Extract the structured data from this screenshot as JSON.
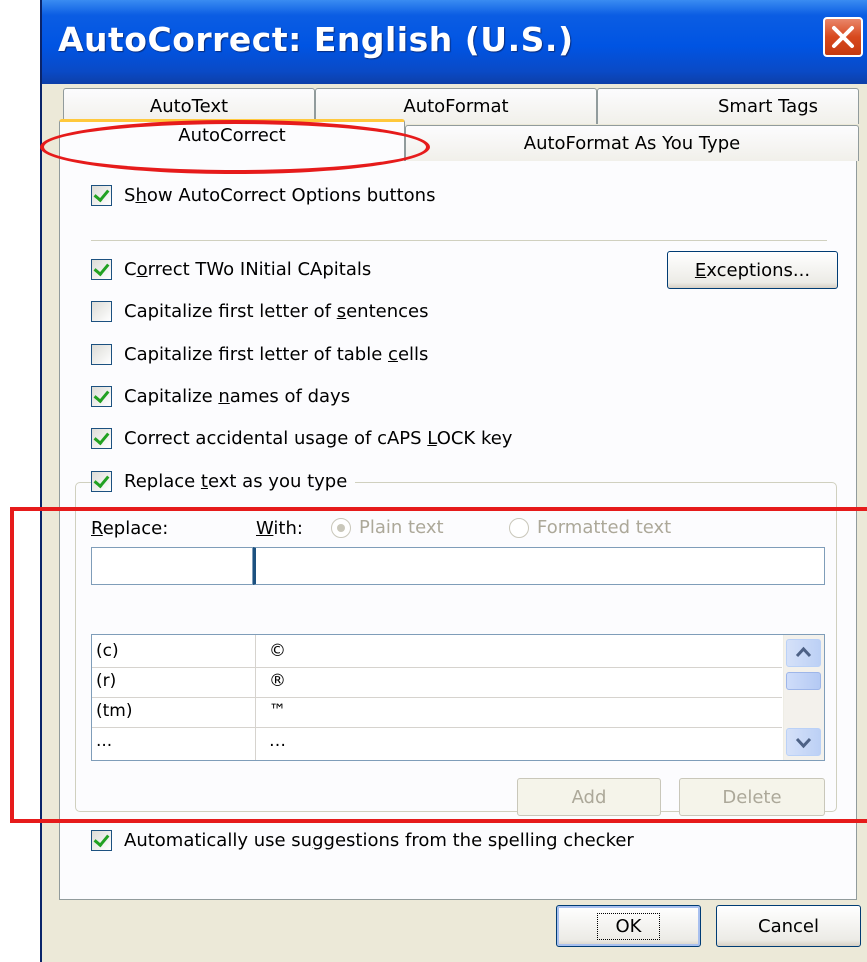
{
  "window": {
    "title": "AutoCorrect: English (U.S.)"
  },
  "tabs": {
    "row1": [
      "AutoText",
      "AutoFormat",
      "Smart Tags"
    ],
    "row2": [
      "AutoCorrect",
      "AutoFormat As You Type"
    ]
  },
  "options": {
    "show_buttons": {
      "label_pre": "S",
      "label_u": "h",
      "label_post": "ow AutoCorrect Options buttons",
      "checked": true
    },
    "two_initial": {
      "label_pre": "C",
      "label_u": "o",
      "label_post": "rrect TWo INitial CApitals",
      "checked": true
    },
    "first_sentence": {
      "label_pre": "Capitalize first letter of ",
      "label_u": "s",
      "label_post": "entences",
      "checked": false
    },
    "first_cell": {
      "label_pre": "Capitalize first letter of table ",
      "label_u": "c",
      "label_post": "ells",
      "checked": false
    },
    "days": {
      "label_pre": "Capitalize ",
      "label_u": "n",
      "label_post": "ames of days",
      "checked": true
    },
    "caps_lock": {
      "label_pre": "Correct accidental usage of cAPS ",
      "label_u": "L",
      "label_post": "OCK key",
      "checked": true
    },
    "replace_text": {
      "label_pre": "Replace ",
      "label_u": "t",
      "label_post": "ext as you type",
      "checked": true
    },
    "spelling": {
      "label_pre": "Automatically use su",
      "label_u": "g",
      "label_post": "gestions from the spelling checker",
      "checked": true
    }
  },
  "buttons": {
    "exceptions_u": "E",
    "exceptions_rest": "xceptions...",
    "add": "Add",
    "delete": "Delete",
    "ok": "OK",
    "cancel": "Cancel"
  },
  "replace_section": {
    "replace_label_u": "R",
    "replace_label_rest": "eplace:",
    "with_label_u": "W",
    "with_label_rest": "ith:",
    "plain_text": "Plain text",
    "formatted_text": "Formatted text",
    "replace_value": "",
    "with_value": ""
  },
  "entries": [
    {
      "replace": "(c)",
      "with": "©"
    },
    {
      "replace": "(r)",
      "with": "®"
    },
    {
      "replace": "(tm)",
      "with": "™"
    },
    {
      "replace": "...",
      "with": "…"
    }
  ],
  "colors": {
    "annotation": "#e61b1b",
    "titlebar": "#0054e3",
    "dialog_bg": "#ece9d8"
  }
}
